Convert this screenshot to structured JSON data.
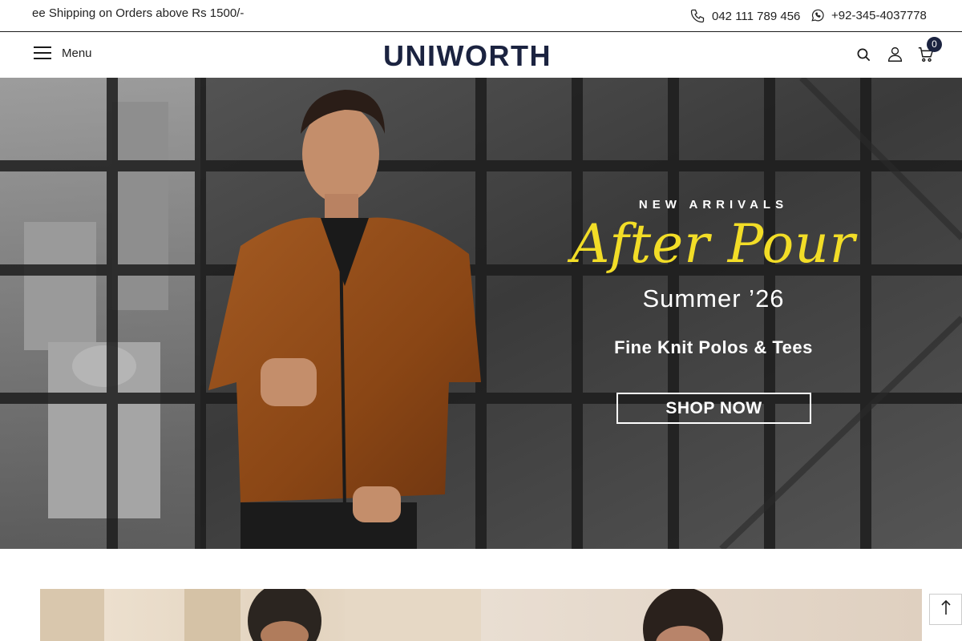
{
  "announcement": {
    "promo_text": "ee Shipping on Orders above Rs 1500/-",
    "phone": "042 111 789 456",
    "whatsapp": "+92-345-4037778",
    "icons": [
      "phone-icon",
      "whatsapp-icon"
    ]
  },
  "header": {
    "menu_label": "Menu",
    "logo_text": "UNIWORTH",
    "cart_count": "0",
    "icons": [
      "search-icon",
      "account-icon",
      "cart-icon"
    ],
    "brand_color": "#1b2340"
  },
  "hero": {
    "eyebrow": "NEW ARRIVALS",
    "headline": "After Pour",
    "season": "Summer ’26",
    "collection": "Fine Knit Polos & Tees",
    "cta_label": "SHOP NOW",
    "headline_color": "#f2dd27"
  },
  "utility": {
    "back_to_top_icon": "arrow-up-icon"
  }
}
